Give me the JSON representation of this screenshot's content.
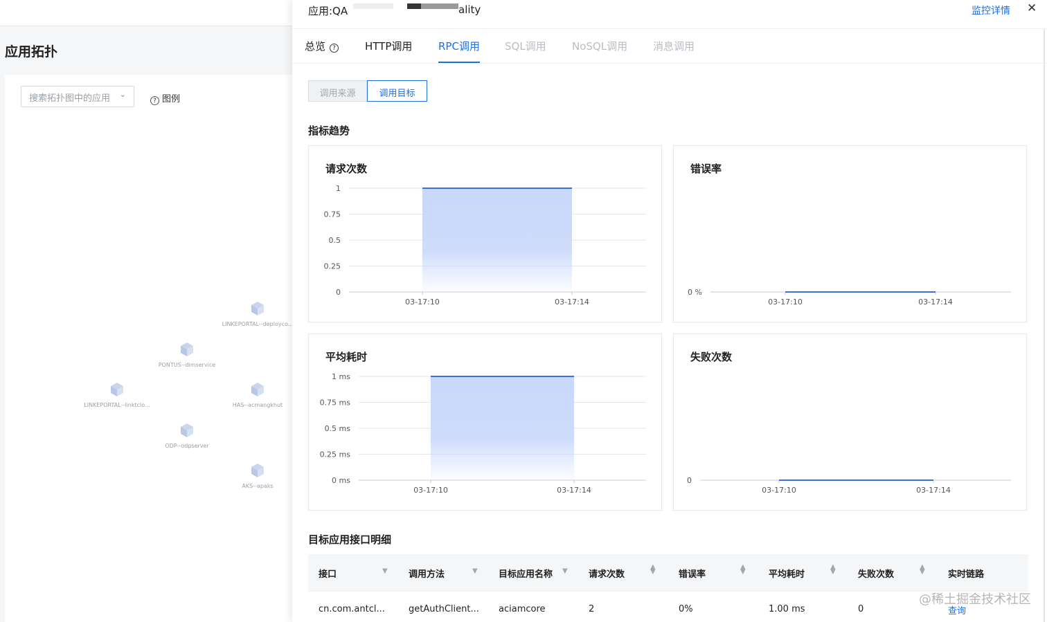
{
  "background_page": {
    "title": "应用拓扑",
    "search_placeholder": "搜索拓扑图中的应用",
    "legend_label": "图例",
    "legend_icon": "question-circle-icon",
    "nodes": [
      {
        "label": "LINKEPORTAL--deployco..."
      },
      {
        "label": "PONTUS--dimservice"
      },
      {
        "label": "LINKEPORTAL--linktclo..."
      },
      {
        "label": "HAS--acmangkhut"
      },
      {
        "label": "ODP--odpserver"
      },
      {
        "label": "AKS--apaks"
      }
    ]
  },
  "panel": {
    "app_title_prefix": "应用:QA",
    "app_title_suffix": "ality",
    "monitor_link": "监控详情",
    "close_icon": "close-icon",
    "tabs": [
      {
        "label": "总览"
      },
      {
        "label": "HTTP调用"
      },
      {
        "label": "RPC调用"
      },
      {
        "label": "SQL调用"
      },
      {
        "label": "NoSQL调用"
      },
      {
        "label": "消息调用"
      }
    ],
    "active_tab": "RPC调用",
    "segments": {
      "source": "调用来源",
      "target": "调用目标",
      "selected": "调用目标"
    },
    "metrics_title": "指标趋势",
    "table_title": "目标应用接口明细"
  },
  "chart_data": [
    {
      "type": "area",
      "title": "请求次数",
      "x": [
        "03-17:10",
        "03-17:14"
      ],
      "y_ticks": [
        "1",
        "0.75",
        "0.5",
        "0.25",
        "0"
      ],
      "ylim": [
        0,
        1
      ],
      "series": [
        {
          "values": [
            1,
            1
          ]
        }
      ]
    },
    {
      "type": "line",
      "title": "错误率",
      "x": [
        "03-17:10",
        "03-17:14"
      ],
      "y_ticks": [
        "0 %"
      ],
      "series": [
        {
          "values": [
            0,
            0
          ]
        }
      ]
    },
    {
      "type": "area",
      "title": "平均耗时",
      "x": [
        "03-17:10",
        "03-17:14"
      ],
      "y_ticks": [
        "1 ms",
        "0.75 ms",
        "0.5 ms",
        "0.25 ms",
        "0 ms"
      ],
      "ylim": [
        0,
        1
      ],
      "series": [
        {
          "values": [
            1,
            1
          ]
        }
      ]
    },
    {
      "type": "line",
      "title": "失败次数",
      "x": [
        "03-17:10",
        "03-17:14"
      ],
      "y_ticks": [
        "0"
      ],
      "series": [
        {
          "values": [
            0,
            0
          ]
        }
      ]
    }
  ],
  "table": {
    "columns": [
      "接口",
      "调用方法",
      "目标应用名称",
      "请求次数",
      "错误率",
      "平均耗时",
      "失败次数",
      "实时链路"
    ],
    "rows": [
      {
        "interface": "cn.com.antcl...",
        "method": "getAuthClient...",
        "target_app": "aciamcore",
        "requests": "2",
        "error_rate": "0%",
        "avg_latency": "1.00 ms",
        "failures": "0",
        "trace": "查询"
      }
    ]
  },
  "watermark": "@稀土掘金技术社区",
  "colors": {
    "accent": "#1e6fe0",
    "area_fill": "#c9d8fb",
    "line": "#3b6fe0"
  }
}
